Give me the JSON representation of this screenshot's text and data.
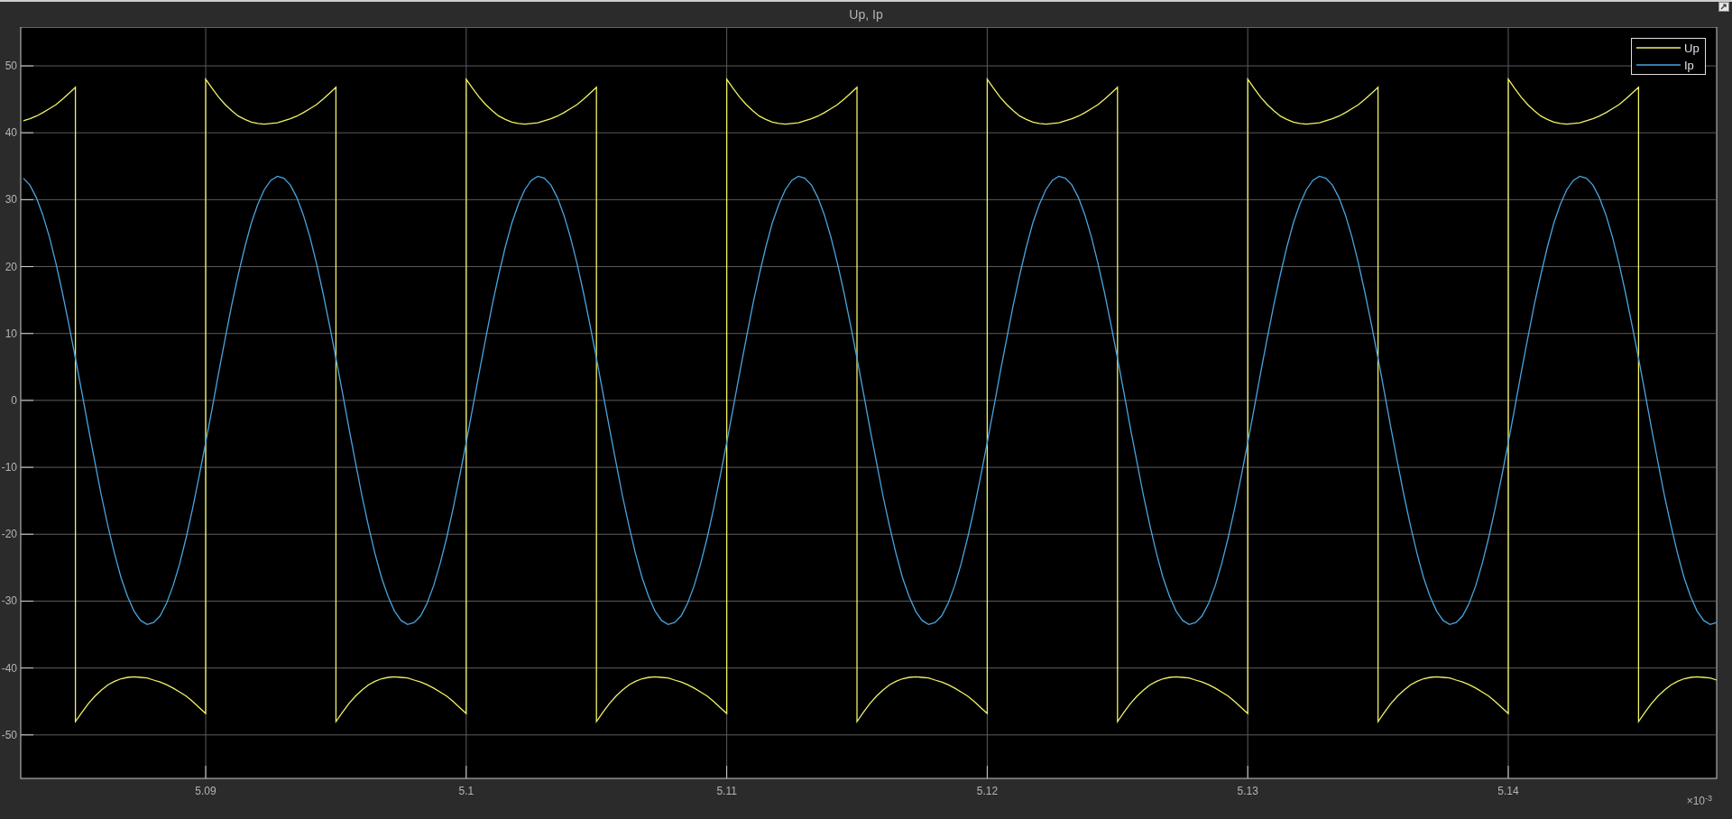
{
  "figure": {
    "x_multiplier": "×10$^{-3}$",
    "chart_data": {
      "type": "line",
      "title": "Up, Ip",
      "grid": true,
      "legend": true,
      "x": [
        5.083,
        5.08325,
        5.0835,
        5.08375,
        5.084,
        5.08425,
        5.0845,
        5.08475,
        5.085,
        5.085,
        5.08525,
        5.0855,
        5.08575,
        5.086,
        5.08625,
        5.0865,
        5.08675,
        5.087,
        5.08725,
        5.0875,
        5.08775,
        5.088,
        5.08825,
        5.0885,
        5.08875,
        5.089,
        5.08925,
        5.0895,
        5.08975,
        5.09,
        5.09,
        5.09025,
        5.0905,
        5.09075,
        5.091,
        5.09125,
        5.0915,
        5.09175,
        5.092,
        5.09225,
        5.0925,
        5.09275,
        5.093,
        5.09325,
        5.0935,
        5.09375,
        5.094,
        5.09425,
        5.0945,
        5.09475,
        5.095,
        5.095,
        5.09525,
        5.0955,
        5.09575,
        5.096,
        5.09625,
        5.0965,
        5.09675,
        5.097,
        5.09725,
        5.0975,
        5.09775,
        5.098,
        5.09825,
        5.0985,
        5.09875,
        5.099,
        5.09925,
        5.0995,
        5.09975,
        5.1,
        5.1,
        5.10025,
        5.1005,
        5.10075,
        5.101,
        5.10125,
        5.1015,
        5.10175,
        5.102,
        5.10225,
        5.1025,
        5.10275,
        5.103,
        5.10325,
        5.1035,
        5.10375,
        5.104,
        5.10425,
        5.1045,
        5.10475,
        5.105,
        5.105,
        5.10525,
        5.1055,
        5.10575,
        5.106,
        5.10625,
        5.1065,
        5.10675,
        5.107,
        5.10725,
        5.1075,
        5.10775,
        5.108,
        5.10825,
        5.1085,
        5.10875,
        5.109,
        5.10925,
        5.1095,
        5.10975,
        5.11,
        5.11,
        5.11025,
        5.1105,
        5.11075,
        5.111,
        5.11125,
        5.1115,
        5.11175,
        5.112,
        5.11225,
        5.1125,
        5.11275,
        5.113,
        5.11325,
        5.1135,
        5.11375,
        5.114,
        5.11425,
        5.1145,
        5.11475,
        5.115,
        5.115,
        5.11525,
        5.1155,
        5.11575,
        5.116,
        5.11625,
        5.1165,
        5.11675,
        5.117,
        5.11725,
        5.1175,
        5.11775,
        5.118,
        5.11825,
        5.1185,
        5.11875,
        5.119,
        5.11925,
        5.1195,
        5.11975,
        5.12,
        5.12,
        5.12025,
        5.1205,
        5.12075,
        5.121,
        5.12125,
        5.1215,
        5.12175,
        5.122,
        5.12225,
        5.1225,
        5.12275,
        5.123,
        5.12325,
        5.1235,
        5.12375,
        5.124,
        5.12425,
        5.1245,
        5.12475,
        5.125,
        5.125,
        5.12525,
        5.1255,
        5.12575,
        5.126,
        5.12625,
        5.1265,
        5.12675,
        5.127,
        5.12725,
        5.1275,
        5.12775,
        5.128,
        5.12825,
        5.1285,
        5.12875,
        5.129,
        5.12925,
        5.1295,
        5.12975,
        5.13,
        5.13,
        5.13025,
        5.1305,
        5.13075,
        5.131,
        5.13125,
        5.1315,
        5.13175,
        5.132,
        5.13225,
        5.1325,
        5.13275,
        5.133,
        5.13325,
        5.1335,
        5.13375,
        5.134,
        5.13425,
        5.1345,
        5.13475,
        5.135,
        5.135,
        5.13525,
        5.1355,
        5.13575,
        5.136,
        5.13625,
        5.1365,
        5.13675,
        5.137,
        5.13725,
        5.1375,
        5.13775,
        5.138,
        5.13825,
        5.1385,
        5.13875,
        5.139,
        5.13925,
        5.1395,
        5.13975,
        5.14,
        5.14,
        5.14025,
        5.1405,
        5.14075,
        5.141,
        5.14125,
        5.1415,
        5.14175,
        5.142,
        5.14225,
        5.1425,
        5.14275,
        5.143,
        5.14325,
        5.1435,
        5.14375,
        5.144,
        5.14425,
        5.1445,
        5.14475,
        5.145,
        5.145,
        5.14525,
        5.1455,
        5.14575,
        5.146,
        5.14625,
        5.1465,
        5.14675,
        5.147,
        5.14725,
        5.1475,
        5.14775,
        5.148
      ],
      "series": [
        {
          "name": "Up",
          "color": "#f2f266",
          "values": [
            41.8,
            42.1,
            42.5,
            43.0,
            43.6,
            44.2,
            45.0,
            45.9,
            46.8,
            -48,
            -46.6,
            -45.3,
            -44.2,
            -43.3,
            -42.5,
            -42.0,
            -41.6,
            -41.4,
            -41.3,
            -41.4,
            -41.5,
            -41.8,
            -42.1,
            -42.5,
            -43.0,
            -43.6,
            -44.2,
            -45.0,
            -45.9,
            -46.8,
            48,
            46.6,
            45.3,
            44.2,
            43.3,
            42.5,
            42.0,
            41.6,
            41.4,
            41.3,
            41.4,
            41.5,
            41.8,
            42.1,
            42.5,
            43.0,
            43.6,
            44.2,
            45.0,
            45.9,
            46.8,
            -48,
            -46.6,
            -45.3,
            -44.2,
            -43.3,
            -42.5,
            -42.0,
            -41.6,
            -41.4,
            -41.3,
            -41.4,
            -41.5,
            -41.8,
            -42.1,
            -42.5,
            -43.0,
            -43.6,
            -44.2,
            -45.0,
            -45.9,
            -46.8,
            48,
            46.6,
            45.3,
            44.2,
            43.3,
            42.5,
            42.0,
            41.6,
            41.4,
            41.3,
            41.4,
            41.5,
            41.8,
            42.1,
            42.5,
            43.0,
            43.6,
            44.2,
            45.0,
            45.9,
            46.8,
            -48,
            -46.6,
            -45.3,
            -44.2,
            -43.3,
            -42.5,
            -42.0,
            -41.6,
            -41.4,
            -41.3,
            -41.4,
            -41.5,
            -41.8,
            -42.1,
            -42.5,
            -43.0,
            -43.6,
            -44.2,
            -45.0,
            -45.9,
            -46.8,
            48,
            46.6,
            45.3,
            44.2,
            43.3,
            42.5,
            42.0,
            41.6,
            41.4,
            41.3,
            41.4,
            41.5,
            41.8,
            42.1,
            42.5,
            43.0,
            43.6,
            44.2,
            45.0,
            45.9,
            46.8,
            -48,
            -46.6,
            -45.3,
            -44.2,
            -43.3,
            -42.5,
            -42.0,
            -41.6,
            -41.4,
            -41.3,
            -41.4,
            -41.5,
            -41.8,
            -42.1,
            -42.5,
            -43.0,
            -43.6,
            -44.2,
            -45.0,
            -45.9,
            -46.8,
            48,
            46.6,
            45.3,
            44.2,
            43.3,
            42.5,
            42.0,
            41.6,
            41.4,
            41.3,
            41.4,
            41.5,
            41.8,
            42.1,
            42.5,
            43.0,
            43.6,
            44.2,
            45.0,
            45.9,
            46.8,
            -48,
            -46.6,
            -45.3,
            -44.2,
            -43.3,
            -42.5,
            -42.0,
            -41.6,
            -41.4,
            -41.3,
            -41.4,
            -41.5,
            -41.8,
            -42.1,
            -42.5,
            -43.0,
            -43.6,
            -44.2,
            -45.0,
            -45.9,
            -46.8,
            48,
            46.6,
            45.3,
            44.2,
            43.3,
            42.5,
            42.0,
            41.6,
            41.4,
            41.3,
            41.4,
            41.5,
            41.8,
            42.1,
            42.5,
            43.0,
            43.6,
            44.2,
            45.0,
            45.9,
            46.8,
            -48,
            -46.6,
            -45.3,
            -44.2,
            -43.3,
            -42.5,
            -42.0,
            -41.6,
            -41.4,
            -41.3,
            -41.4,
            -41.5,
            -41.8,
            -42.1,
            -42.5,
            -43.0,
            -43.6,
            -44.2,
            -45.0,
            -45.9,
            -46.8,
            48,
            46.6,
            45.3,
            44.2,
            43.3,
            42.5,
            42.0,
            41.6,
            41.4,
            41.3,
            41.4,
            41.5,
            41.8,
            42.1,
            42.5,
            43.0,
            43.6,
            44.2,
            45.0,
            45.9,
            46.8,
            -48,
            -46.6,
            -45.3,
            -44.2,
            -43.3,
            -42.5,
            -42.0,
            -41.6,
            -41.4,
            -41.3,
            -41.4,
            -41.5,
            -41.8
          ]
        },
        {
          "name": "Ip",
          "color": "#4aa3df",
          "values": [
            33.2,
            32.2,
            30.3,
            27.7,
            24.4,
            20.5,
            16.1,
            11.3,
            6.3,
            6.3,
            1.1,
            -4.2,
            -9.3,
            -14.3,
            -18.8,
            -22.9,
            -26.5,
            -29.3,
            -31.5,
            -32.9,
            -33.5,
            -33.2,
            -32.2,
            -30.3,
            -27.7,
            -24.4,
            -20.5,
            -16.1,
            -11.3,
            -6.3,
            -6.3,
            -1.1,
            4.2,
            9.3,
            14.3,
            18.8,
            22.9,
            26.5,
            29.3,
            31.5,
            32.9,
            33.5,
            33.2,
            32.2,
            30.3,
            27.7,
            24.4,
            20.5,
            16.1,
            11.3,
            6.3,
            6.3,
            1.1,
            -4.2,
            -9.3,
            -14.3,
            -18.8,
            -22.9,
            -26.5,
            -29.3,
            -31.5,
            -32.9,
            -33.5,
            -33.2,
            -32.2,
            -30.3,
            -27.7,
            -24.4,
            -20.5,
            -16.1,
            -11.3,
            -6.3,
            -6.3,
            -1.1,
            4.2,
            9.3,
            14.3,
            18.8,
            22.9,
            26.5,
            29.3,
            31.5,
            32.9,
            33.5,
            33.2,
            32.2,
            30.3,
            27.7,
            24.4,
            20.5,
            16.1,
            11.3,
            6.3,
            6.3,
            1.1,
            -4.2,
            -9.3,
            -14.3,
            -18.8,
            -22.9,
            -26.5,
            -29.3,
            -31.5,
            -32.9,
            -33.5,
            -33.2,
            -32.2,
            -30.3,
            -27.7,
            -24.4,
            -20.5,
            -16.1,
            -11.3,
            -6.3,
            -6.3,
            -1.1,
            4.2,
            9.3,
            14.3,
            18.8,
            22.9,
            26.5,
            29.3,
            31.5,
            32.9,
            33.5,
            33.2,
            32.2,
            30.3,
            27.7,
            24.4,
            20.5,
            16.1,
            11.3,
            6.3,
            6.3,
            1.1,
            -4.2,
            -9.3,
            -14.3,
            -18.8,
            -22.9,
            -26.5,
            -29.3,
            -31.5,
            -32.9,
            -33.5,
            -33.2,
            -32.2,
            -30.3,
            -27.7,
            -24.4,
            -20.5,
            -16.1,
            -11.3,
            -6.3,
            -6.3,
            -1.1,
            4.2,
            9.3,
            14.3,
            18.8,
            22.9,
            26.5,
            29.3,
            31.5,
            32.9,
            33.5,
            33.2,
            32.2,
            30.3,
            27.7,
            24.4,
            20.5,
            16.1,
            11.3,
            6.3,
            6.3,
            1.1,
            -4.2,
            -9.3,
            -14.3,
            -18.8,
            -22.9,
            -26.5,
            -29.3,
            -31.5,
            -32.9,
            -33.5,
            -33.2,
            -32.2,
            -30.3,
            -27.7,
            -24.4,
            -20.5,
            -16.1,
            -11.3,
            -6.3,
            -6.3,
            -1.1,
            4.2,
            9.3,
            14.3,
            18.8,
            22.9,
            26.5,
            29.3,
            31.5,
            32.9,
            33.5,
            33.2,
            32.2,
            30.3,
            27.7,
            24.4,
            20.5,
            16.1,
            11.3,
            6.3,
            6.3,
            1.1,
            -4.2,
            -9.3,
            -14.3,
            -18.8,
            -22.9,
            -26.5,
            -29.3,
            -31.5,
            -32.9,
            -33.5,
            -33.2,
            -32.2,
            -30.3,
            -27.7,
            -24.4,
            -20.5,
            -16.1,
            -11.3,
            -6.3,
            -6.3,
            -1.1,
            4.2,
            9.3,
            14.3,
            18.8,
            22.9,
            26.5,
            29.3,
            31.5,
            32.9,
            33.5,
            33.2,
            32.2,
            30.3,
            27.7,
            24.4,
            20.5,
            16.1,
            11.3,
            6.3,
            6.3,
            1.1,
            -4.2,
            -9.3,
            -14.3,
            -18.8,
            -22.9,
            -26.5,
            -29.3,
            -31.5,
            -32.9,
            -33.5,
            -33.2
          ]
        }
      ],
      "xlim": [
        5.0829,
        5.148
      ],
      "ylim": [
        -56.5,
        55.8
      ],
      "xticks": [
        {
          "value": 5.09,
          "label": "5.09"
        },
        {
          "value": 5.1,
          "label": "5.1"
        },
        {
          "value": 5.11,
          "label": "5.11"
        },
        {
          "value": 5.12,
          "label": "5.12"
        },
        {
          "value": 5.13,
          "label": "5.13"
        },
        {
          "value": 5.14,
          "label": "5.14"
        }
      ],
      "yticks": [
        -50,
        -40,
        -30,
        -20,
        -10,
        0,
        10,
        20,
        30,
        40,
        50
      ]
    }
  }
}
